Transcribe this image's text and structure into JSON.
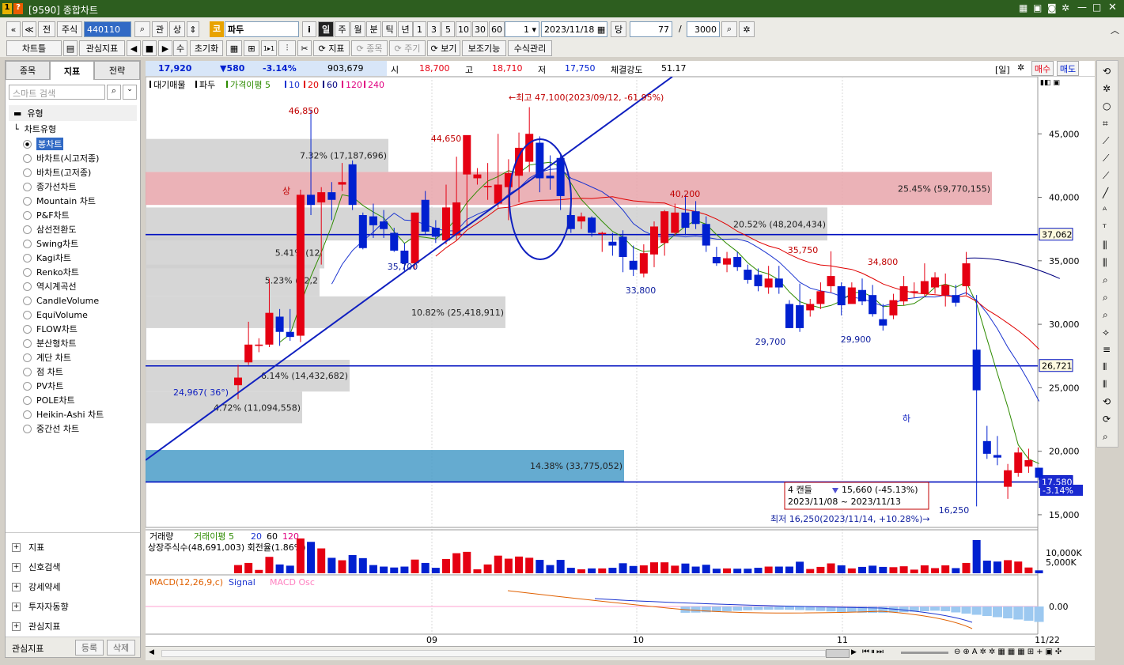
{
  "window": {
    "title": "[9590] 종합차트",
    "badge1": "1",
    "badge2": "?"
  },
  "toolbar1": {
    "nav_back": "«",
    "nav_up": "≪",
    "prev": "전",
    "market": "주식",
    "code": "440110",
    "issuer_badge": "코",
    "stock_name": "파두",
    "info": "i",
    "periods": [
      "일",
      "주",
      "월",
      "분",
      "틱",
      "년"
    ],
    "active_period": "일",
    "intervals": [
      "1",
      "3",
      "5",
      "10",
      "30",
      "60"
    ],
    "count_select": "1",
    "date": "2023/11/18",
    "unit_label": "당",
    "bars_shown": "77",
    "bars_total": "3000",
    "separator": "/"
  },
  "toolbar2": {
    "chart_btn": "차트틀",
    "indicator_btn": "관심지표",
    "play_labels": [
      "◀",
      "■",
      "▶"
    ],
    "su": "수",
    "reset": "초기화",
    "indicator": "지표",
    "stock_btn": "종목",
    "cycle_btn": "주기",
    "view": "보기",
    "aux": "보조기능",
    "formula": "수식관리"
  },
  "left_panel": {
    "tabs": [
      "종목",
      "지표",
      "전략"
    ],
    "active_tab": "지표",
    "search_placeholder": "스마트 검색",
    "section": "유형",
    "group": "차트유형",
    "chart_types": [
      "봉차트",
      "바차트(시고저종)",
      "바차트(고저종)",
      "종가선차트",
      "Mountain 차트",
      "P&F차트",
      "삼선전환도",
      "Swing차트",
      "Kagi차트",
      "Renko차트",
      "역시계곡선",
      "CandleVolume",
      "EquiVolume",
      "FLOW차트",
      "분산형차트",
      "계단 차트",
      "점 차트",
      "PV차트",
      "POLE차트",
      "Heikin-Ashi 차트",
      "중간선 차트"
    ],
    "selected_type": "봉차트",
    "tree": [
      "지표",
      "신호검색",
      "강세약세",
      "투자자동향",
      "관심지표"
    ],
    "footer_label": "관심지표",
    "register": "등록",
    "delete": "삭제"
  },
  "info_bar": {
    "price": "17,920",
    "change": "▼580",
    "pct": "-3.14%",
    "volume": "903,679",
    "open_lbl": "시",
    "open": "18,700",
    "high_lbl": "고",
    "high": "18,710",
    "low_lbl": "저",
    "low": "17,750",
    "strength_lbl": "체결강도",
    "strength": "51.17",
    "period_tag": "[일]",
    "buy": "매수",
    "sell": "매도"
  },
  "chart_legend": {
    "items": [
      "대기매물",
      "파두",
      "가격이평 5",
      "10",
      "20",
      "60",
      "120",
      "240"
    ]
  },
  "chart_data": {
    "type": "candlestick",
    "y_ticks": [
      "45,000",
      "40,000",
      "35,000",
      "30,000",
      "25,000",
      "20,000",
      "15,000"
    ],
    "x_ticks": [
      "09",
      "10",
      "11",
      "11/22"
    ],
    "ylim": [
      14000,
      49500
    ],
    "candles": [
      [
        25200,
        25800,
        24100,
        26800
      ],
      [
        27000,
        28400,
        26800,
        30200
      ],
      [
        28300,
        28400,
        27800,
        28900
      ],
      [
        28400,
        30900,
        28200,
        33600
      ],
      [
        30600,
        29400,
        28300,
        31200
      ],
      [
        29400,
        29000,
        28700,
        31200
      ],
      [
        29100,
        40200,
        28600,
        40600
      ],
      [
        40200,
        39400,
        38600,
        46850
      ],
      [
        39600,
        40400,
        34700,
        40800
      ],
      [
        40400,
        39800,
        38200,
        41200
      ],
      [
        41000,
        41200,
        40500,
        42700
      ],
      [
        42600,
        39400,
        39000,
        42900
      ],
      [
        38600,
        36000,
        35900,
        38800
      ],
      [
        38500,
        37800,
        36800,
        39500
      ],
      [
        38100,
        37500,
        36800,
        39000
      ],
      [
        37200,
        35800,
        35700,
        37600
      ],
      [
        35800,
        34800,
        34200,
        36400
      ],
      [
        34800,
        38800,
        34300,
        38800
      ],
      [
        39800,
        37300,
        37100,
        40500
      ],
      [
        37600,
        36900,
        36400,
        38200
      ],
      [
        36600,
        39200,
        36300,
        41000
      ],
      [
        37000,
        39600,
        36600,
        43200
      ],
      [
        41800,
        44900,
        37600,
        44650
      ],
      [
        41500,
        41800,
        41000,
        42300
      ],
      [
        40800,
        40900,
        39800,
        42700
      ],
      [
        39500,
        41000,
        39200,
        45000
      ],
      [
        40800,
        41900,
        38200,
        43000
      ],
      [
        41700,
        43900,
        39600,
        45100
      ],
      [
        42800,
        45000,
        42000,
        47100
      ],
      [
        44300,
        41500,
        40400,
        44800
      ],
      [
        41700,
        41500,
        40600,
        43300
      ],
      [
        43100,
        40100,
        39000,
        43400
      ],
      [
        38600,
        37500,
        37200,
        39000
      ],
      [
        38100,
        38500,
        37500,
        38800
      ],
      [
        38400,
        37200,
        36900,
        38500
      ],
      [
        37100,
        37200,
        35700,
        37300
      ],
      [
        36500,
        36200,
        35400,
        37200
      ],
      [
        36900,
        35300,
        34100,
        37400
      ],
      [
        35000,
        34300,
        33800,
        36200
      ],
      [
        34000,
        35600,
        33700,
        36300
      ],
      [
        35500,
        37700,
        34500,
        38100
      ],
      [
        36400,
        38900,
        35400,
        39000
      ],
      [
        37200,
        38800,
        37000,
        39500
      ],
      [
        38800,
        37600,
        37000,
        40200
      ],
      [
        38900,
        37900,
        37500,
        39700
      ],
      [
        37900,
        36200,
        35700,
        38500
      ],
      [
        35300,
        34800,
        34600,
        36100
      ],
      [
        34700,
        35200,
        34100,
        35700
      ],
      [
        35300,
        34500,
        34200,
        35700
      ],
      [
        34300,
        33500,
        33200,
        34700
      ],
      [
        33900,
        33000,
        32600,
        34400
      ],
      [
        32900,
        33600,
        32400,
        34600
      ],
      [
        33600,
        32900,
        32400,
        34600
      ],
      [
        31600,
        29700,
        29700,
        31900
      ],
      [
        31500,
        29700,
        29400,
        33200
      ],
      [
        31100,
        31600,
        30600,
        32000
      ],
      [
        31600,
        32600,
        31200,
        33300
      ],
      [
        33000,
        33800,
        32500,
        35750
      ],
      [
        33000,
        31500,
        30700,
        33300
      ],
      [
        31600,
        32900,
        31700,
        33300
      ],
      [
        32700,
        31800,
        31500,
        33600
      ],
      [
        32300,
        30800,
        30600,
        33100
      ],
      [
        30400,
        29900,
        29500,
        31600
      ],
      [
        30700,
        31900,
        30400,
        32400
      ],
      [
        31800,
        33000,
        31500,
        33800
      ],
      [
        32500,
        32600,
        32100,
        33300
      ],
      [
        32400,
        33400,
        32200,
        34800
      ],
      [
        32900,
        33700,
        32400,
        34100
      ],
      [
        32300,
        33100,
        31400,
        34000
      ],
      [
        32300,
        31700,
        31400,
        33100
      ],
      [
        33000,
        34800,
        32300,
        35700
      ],
      [
        28000,
        24800,
        15660,
        32300
      ],
      [
        20800,
        19800,
        19400,
        22000
      ],
      [
        19700,
        19500,
        18900,
        21200
      ],
      [
        17200,
        18500,
        16250,
        19000
      ],
      [
        18300,
        19900,
        18000,
        20300
      ],
      [
        18800,
        19300,
        18300,
        20200
      ],
      [
        18700,
        17920,
        17750,
        18710
      ]
    ],
    "resistance_zones": [
      {
        "label": "25.45% (59,770,155)",
        "low": 39400,
        "high": 42000
      },
      {
        "label": "20.52% (48,204,434)",
        "low": 36600,
        "high": 39200
      },
      {
        "label": "14.38% (33,775,052)",
        "low": 17600,
        "high": 20100
      },
      {
        "label": "10.82% (25,418,911)",
        "low": 29700,
        "high": 32200
      },
      {
        "label": "7.32% (17,187,696)",
        "low": 42000,
        "high": 44600
      },
      {
        "label": "6.14% (14,432,682)",
        "low": 24700,
        "high": 27200
      },
      {
        "label": "5.41% (12,",
        "low": 34400,
        "high": 36900
      },
      {
        "label": "5.23% (12,2",
        "low": 32200,
        "high": 34700
      },
      {
        "label": "4.72% (11,094,558)",
        "low": 22200,
        "high": 24700
      }
    ],
    "hlines": [
      {
        "value": "37,062",
        "price": 37062
      },
      {
        "value": "26,721",
        "price": 26721
      },
      {
        "value": "17,580",
        "price": 17580
      }
    ],
    "annotations": {
      "max_label": "←최고 47,100(2023/09/12, -61.95%)",
      "min_label": "최저 16,250(2023/11/14, +10.28%)→",
      "p46850": "46,850",
      "p44650": "44,650",
      "p40200": "40,200",
      "p35750": "35,750",
      "p34800": "34,800",
      "p35700": "35,700",
      "p33800": "33,800",
      "p29700": "29,700",
      "p29900": "29,900",
      "p16250": "16,250",
      "trend": "24,967( 36°)",
      "up_mark": "상",
      "down_mark": "하",
      "tooltip_line1": "4 캔들",
      "tooltip_line2": "15,660 (-45.13%)",
      "tooltip_line3": "2023/11/08 ~ 2023/11/13",
      "pct_tag": "-3.14%"
    }
  },
  "volume_panel": {
    "legend": [
      "거래량",
      "거래이평 5",
      "20",
      "60",
      "120"
    ],
    "sub": "상장주식수(48,691,003) 회전율(1.86%)",
    "y_ticks": [
      "10,000K",
      "5,000K"
    ]
  },
  "macd_panel": {
    "legend": [
      "MACD(12,26,9,c)",
      "Signal",
      "MACD Osc"
    ],
    "y_tick": "0.00"
  },
  "colors": {
    "up": "#e50012",
    "down": "#0020d0",
    "title_bg": "#2d5e1f",
    "zone_red": "#e8a4aa",
    "zone_grey": "#cfcfcf",
    "zone_blue": "#4a9cc8"
  }
}
